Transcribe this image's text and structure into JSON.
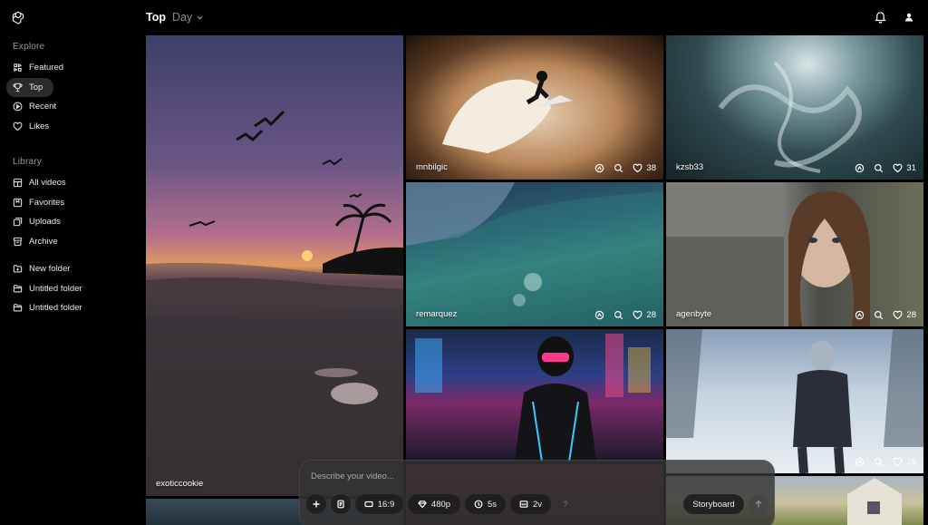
{
  "header": {
    "title": "Top",
    "range": "Day"
  },
  "sidebar": {
    "explore_label": "Explore",
    "explore": [
      {
        "label": "Featured",
        "icon": "featured-icon"
      },
      {
        "label": "Top",
        "icon": "trophy-icon",
        "active": true
      },
      {
        "label": "Recent",
        "icon": "play-circle-icon"
      },
      {
        "label": "Likes",
        "icon": "heart-icon"
      }
    ],
    "library_label": "Library",
    "library": [
      {
        "label": "All videos",
        "icon": "grid-icon"
      },
      {
        "label": "Favorites",
        "icon": "bookmark-icon"
      },
      {
        "label": "Uploads",
        "icon": "uploads-icon"
      },
      {
        "label": "Archive",
        "icon": "archive-icon"
      }
    ],
    "folders": [
      {
        "label": "New folder",
        "icon": "new-folder-icon"
      },
      {
        "label": "Untitled folder",
        "icon": "folder-icon"
      },
      {
        "label": "Untitled folder",
        "icon": "folder-icon"
      }
    ]
  },
  "videos": [
    {
      "user": "exoticcookie"
    },
    {
      "user": "mnbilgic",
      "likes": "38"
    },
    {
      "user": "kzsb33",
      "likes": "31"
    },
    {
      "user": "remarquez",
      "likes": "28"
    },
    {
      "user": "agenbyte",
      "likes": "28"
    },
    {
      "user": "",
      "likes": ""
    },
    {
      "user": "",
      "likes": "25"
    }
  ],
  "composer": {
    "placeholder": "Describe your video...",
    "aspect": "16:9",
    "resolution": "480p",
    "duration": "5s",
    "variations": "2v",
    "help": "?",
    "storyboard": "Storyboard"
  }
}
